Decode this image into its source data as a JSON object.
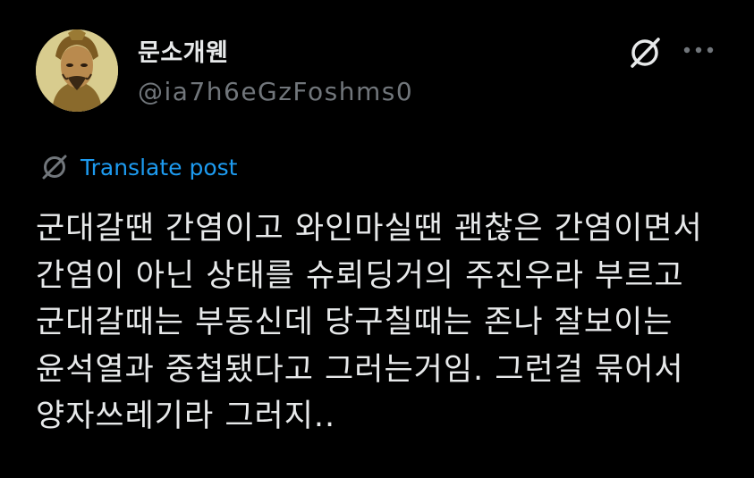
{
  "author": {
    "display_name": "문소개웬",
    "handle": "@ia7h6eGzFoshms0",
    "avatar_icon": "avatar-portrait"
  },
  "header_icons": {
    "grok": "grok-icon",
    "more": "more-icon"
  },
  "translate": {
    "icon": "translate-icon",
    "label": "Translate post"
  },
  "post": {
    "lines": [
      "군대갈땐 간염이고 와인마실땐 괜찮은 간염이면서",
      "간염이 아닌 상태를 슈뢰딩거의 주진우라 부르고",
      "군대갈때는 부동신데 당구칠때는 존나 잘보이는",
      "윤석열과 중첩됐다고 그러는거임. 그런걸 묶어서",
      "양자쓰레기라 그러지.."
    ]
  },
  "colors": {
    "background": "#000000",
    "text": "#e7e9ea",
    "secondary": "#71767b",
    "link": "#1d9bf0"
  }
}
